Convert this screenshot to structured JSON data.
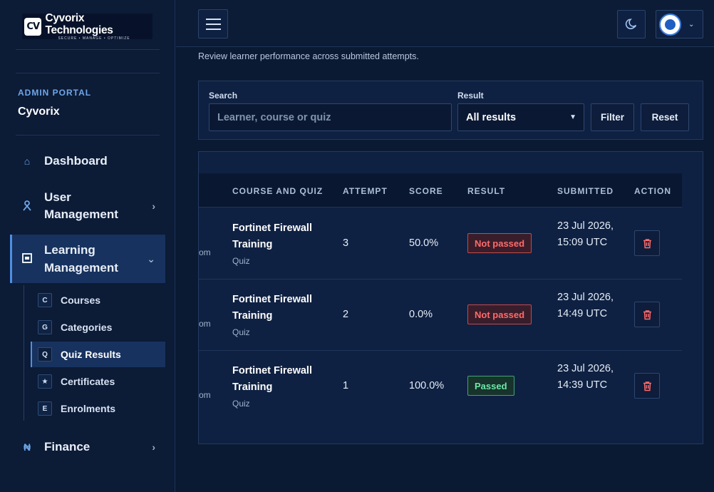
{
  "brand": {
    "name": "Cyvorix Technologies",
    "tagline": "SECURE • MANAGE • OPTIMIZE",
    "mark": "CV"
  },
  "sidebar": {
    "portal_label": "ADMIN PORTAL",
    "portal_name": "Cyvorix",
    "items": [
      {
        "label": "Dashboard",
        "icon": "home-icon"
      },
      {
        "label": "User Management",
        "icon": "user-icon"
      },
      {
        "label": "Learning Management",
        "icon": "book-icon"
      },
      {
        "label": "Finance",
        "icon": "currency-icon"
      }
    ],
    "sub_items": [
      {
        "label": "Courses",
        "badge": "C"
      },
      {
        "label": "Categories",
        "badge": "G"
      },
      {
        "label": "Quiz Results",
        "badge": "Q"
      },
      {
        "label": "Certificates",
        "badge": "★"
      },
      {
        "label": "Enrolments",
        "badge": "E"
      }
    ]
  },
  "page": {
    "subtitle": "Review learner performance across submitted attempts."
  },
  "filters": {
    "search_label": "Search",
    "search_placeholder": "Learner, course or quiz",
    "result_label": "Result",
    "result_value": "All results",
    "filter_button": "Filter",
    "reset_button": "Reset"
  },
  "table": {
    "headers": [
      "COURSE AND QUIZ",
      "ATTEMPT",
      "SCORE",
      "RESULT",
      "SUBMITTED",
      "ACTION"
    ],
    "rows": [
      {
        "cut": "om",
        "course": "Fortinet Firewall Training",
        "type": "Quiz",
        "attempt": "3",
        "score": "50.0%",
        "result": "Not passed",
        "submitted": "23 Jul 2026, 15:09 UTC"
      },
      {
        "cut": "om",
        "course": "Fortinet Firewall Training",
        "type": "Quiz",
        "attempt": "2",
        "score": "0.0%",
        "result": "Not passed",
        "submitted": "23 Jul 2026, 14:49 UTC"
      },
      {
        "cut": "om",
        "course": "Fortinet Firewall Training",
        "type": "Quiz",
        "attempt": "1",
        "score": "100.0%",
        "result": "Passed",
        "submitted": "23 Jul 2026, 14:39 UTC"
      }
    ]
  },
  "colors": {
    "accent": "#4f8fe0",
    "fail": "#ff6b6b",
    "pass": "#6ee7a8",
    "background": "#0b1a33"
  }
}
